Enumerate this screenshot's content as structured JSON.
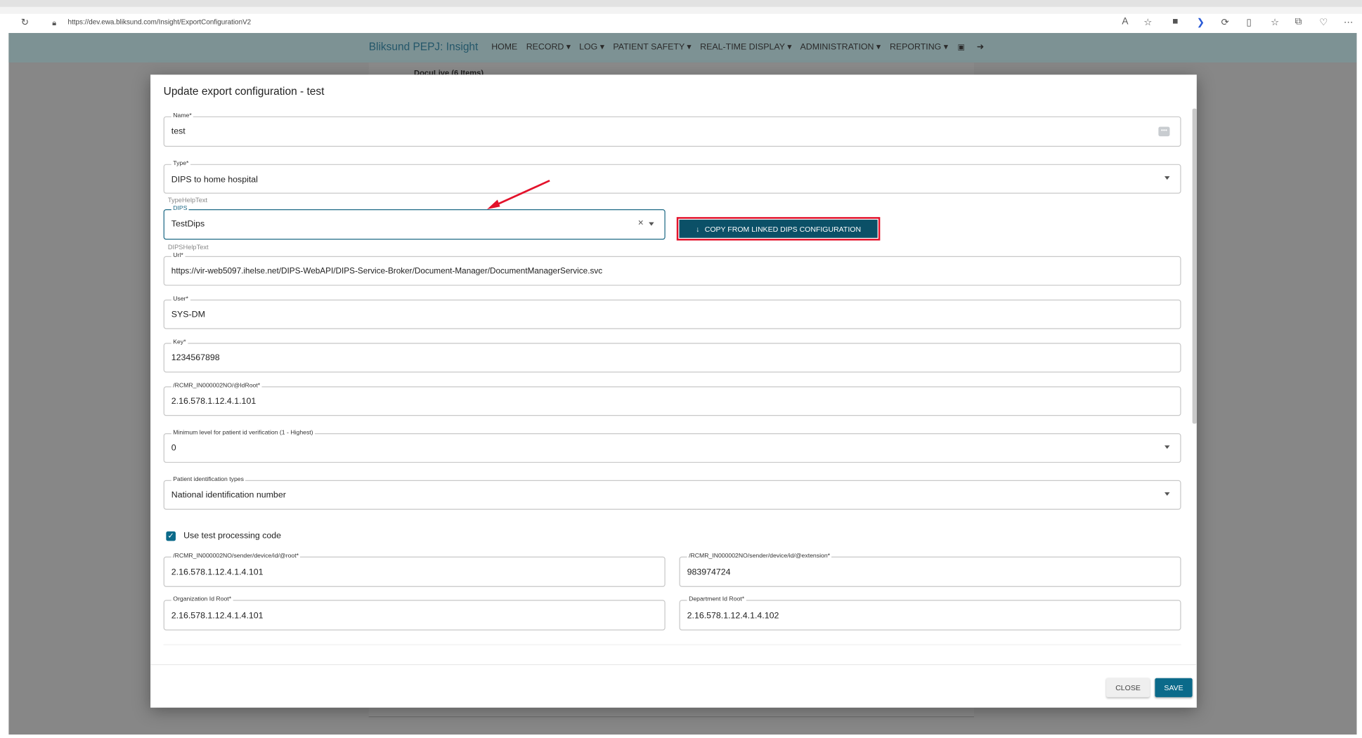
{
  "browser": {
    "url": "https://dev.ewa.bliksund.com/Insight/ExportConfigurationV2"
  },
  "header": {
    "brand": "Bliksund PEPJ: Insight",
    "nav": [
      "HOME",
      "RECORD ▾",
      "LOG ▾",
      "PATIENT SAFETY ▾",
      "REAL-TIME DISPLAY ▾",
      "ADMINISTRATION ▾",
      "REPORTING ▾"
    ]
  },
  "background": {
    "group": "DocuLive (6 Items)"
  },
  "modal": {
    "title": "Update export configuration - test",
    "name": {
      "label": "Name*",
      "value": "test"
    },
    "type": {
      "label": "Type*",
      "value": "DIPS to home hospital",
      "help": "TypeHelpText"
    },
    "dips": {
      "label": "DIPS",
      "value": "TestDips",
      "help": "DIPSHelpText"
    },
    "copy_button": "COPY FROM LINKED DIPS CONFIGURATION",
    "url": {
      "label": "Url*",
      "value": "https://vir-web5097.ihelse.net/DIPS-WebAPI/DIPS-Service-Broker/Document-Manager/DocumentManagerService.svc"
    },
    "user": {
      "label": "User*",
      "value": "SYS-DM"
    },
    "key": {
      "label": "Key*",
      "value": "1234567898"
    },
    "idroot": {
      "label": "/RCMR_IN000002NO/@IdRoot*",
      "value": "2.16.578.1.12.4.1.101"
    },
    "minlevel": {
      "label": "Minimum level for patient id verification (1 - Highest)",
      "value": "0"
    },
    "pidtypes": {
      "label": "Patient identification types",
      "value": "National identification number"
    },
    "testcode": {
      "label": "Use test processing code",
      "checked": true
    },
    "devroot": {
      "label": "/RCMR_IN000002NO/sender/device/id/@root*",
      "value": "2.16.578.1.12.4.1.4.101"
    },
    "devext": {
      "label": "/RCMR_IN000002NO/sender/device/id/@extension*",
      "value": "983974724"
    },
    "orgroot": {
      "label": "Organization Id Root*",
      "value": "2.16.578.1.12.4.1.4.101"
    },
    "deproot": {
      "label": "Department Id Root*",
      "value": "2.16.578.1.12.4.1.4.102"
    },
    "close": "CLOSE",
    "save": "SAVE"
  },
  "colors": {
    "primary": "#0b6a8a",
    "annotation": "#e3122b"
  }
}
